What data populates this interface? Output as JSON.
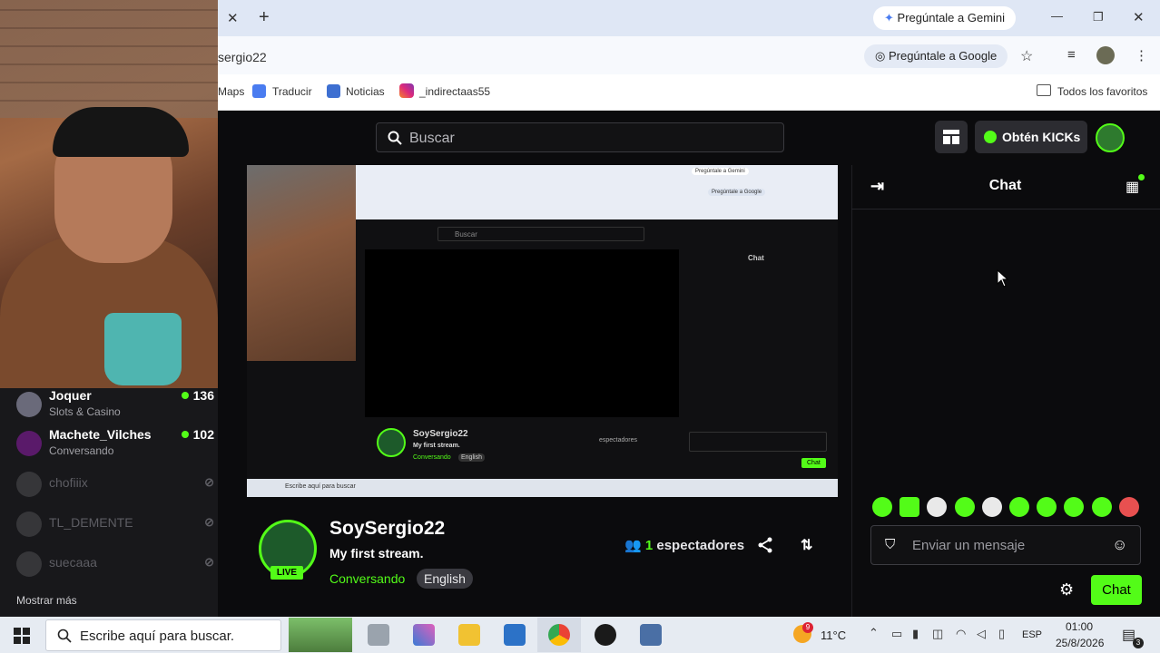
{
  "browser": {
    "new_tab_glyph": "+",
    "close_tab_glyph": "✕",
    "gemini_pill": "Pregúntale a Gemini",
    "url": "sergio22",
    "google_pill": "Pregúntale a Google",
    "bookmarks": [
      {
        "label": "Maps"
      },
      {
        "label": "Traducir"
      },
      {
        "label": "Noticias"
      },
      {
        "label": "_indirectaas55"
      }
    ],
    "all_bookmarks": "Todos los favoritos"
  },
  "header": {
    "search_placeholder": "Buscar",
    "kicks_label": "Obtén KICKs"
  },
  "sidebar": {
    "channels": [
      {
        "name": "Joquer",
        "sub": "Slots & Casino",
        "count": "136",
        "live": true
      },
      {
        "name": "Machete_Vilches",
        "sub": "Conversando",
        "count": "102",
        "live": true
      },
      {
        "name": "chofiiix",
        "live": false
      },
      {
        "name": "TL_DEMENTE",
        "live": false
      },
      {
        "name": "suecaaa",
        "live": false
      }
    ],
    "show_more": "Mostrar más"
  },
  "nested": {
    "gemini": "Pregúntale a Gemini",
    "google": "Pregúntale a Google",
    "search": "Buscar",
    "chat": "Chat",
    "name": "SoySergio22",
    "title": "My first stream.",
    "category": "Conversando",
    "lang": "English",
    "viewers": "espectadores",
    "send": "Chat",
    "taskbar_search": "Escribe aquí para buscar"
  },
  "channel": {
    "name": "SoySergio22",
    "title": "My first stream.",
    "category": "Conversando",
    "language": "English",
    "live_badge": "LIVE",
    "viewer_count": "1",
    "viewer_label": "espectadores"
  },
  "chat": {
    "title": "Chat",
    "input_placeholder": "Enviar un mensaje",
    "send_label": "Chat"
  },
  "taskbar": {
    "search_placeholder": "Escribe aquí para buscar.",
    "weather": "11°C",
    "notification_badge": "9",
    "language": "ESP",
    "time": "01:00",
    "date": "25/8/2026",
    "notif_count": "3"
  },
  "colors": {
    "accent": "#53fc18",
    "background": "#0b0b0d",
    "sidebar": "#18181b"
  }
}
